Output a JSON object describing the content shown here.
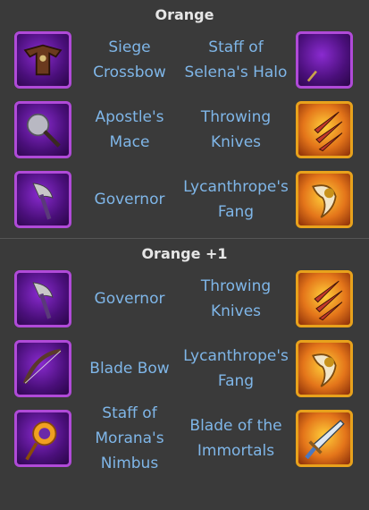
{
  "sections": [
    {
      "title": "Orange",
      "rows": [
        {
          "left": {
            "name": "Siege\nCrossbow",
            "icon": "siege-crossbow-icon"
          },
          "right": {
            "name": "Staff of\nSelena's Halo",
            "icon": "staff-of-selenas-halo-icon"
          }
        },
        {
          "left": {
            "name": "Apostle's\nMace",
            "icon": "apostles-mace-icon"
          },
          "right": {
            "name": "Throwing\nKnives",
            "icon": "throwing-knives-icon"
          }
        },
        {
          "left": {
            "name": "Governor",
            "icon": "governor-icon"
          },
          "right": {
            "name": "Lycanthrope's\nFang",
            "icon": "lycanthropes-fang-icon"
          }
        }
      ]
    },
    {
      "title": "Orange +1",
      "rows": [
        {
          "left": {
            "name": "Governor",
            "icon": "governor-icon"
          },
          "right": {
            "name": "Throwing\nKnives",
            "icon": "throwing-knives-icon"
          }
        },
        {
          "left": {
            "name": "Blade Bow",
            "icon": "blade-bow-icon"
          },
          "right": {
            "name": "Lycanthrope's\nFang",
            "icon": "lycanthropes-fang-icon"
          }
        },
        {
          "left": {
            "name": "Staff of\nMorana's\nNimbus",
            "icon": "staff-of-moranas-nimbus-icon"
          },
          "right": {
            "name": "Blade of the\nImmortals",
            "icon": "blade-of-the-immortals-icon"
          }
        }
      ]
    }
  ],
  "colors": {
    "background": "#3a3a3a",
    "title": "#e6e6e6",
    "item_name": "#7fb6e8",
    "purple_frame": "#b04ad8",
    "gold_frame": "#e8a21c"
  }
}
